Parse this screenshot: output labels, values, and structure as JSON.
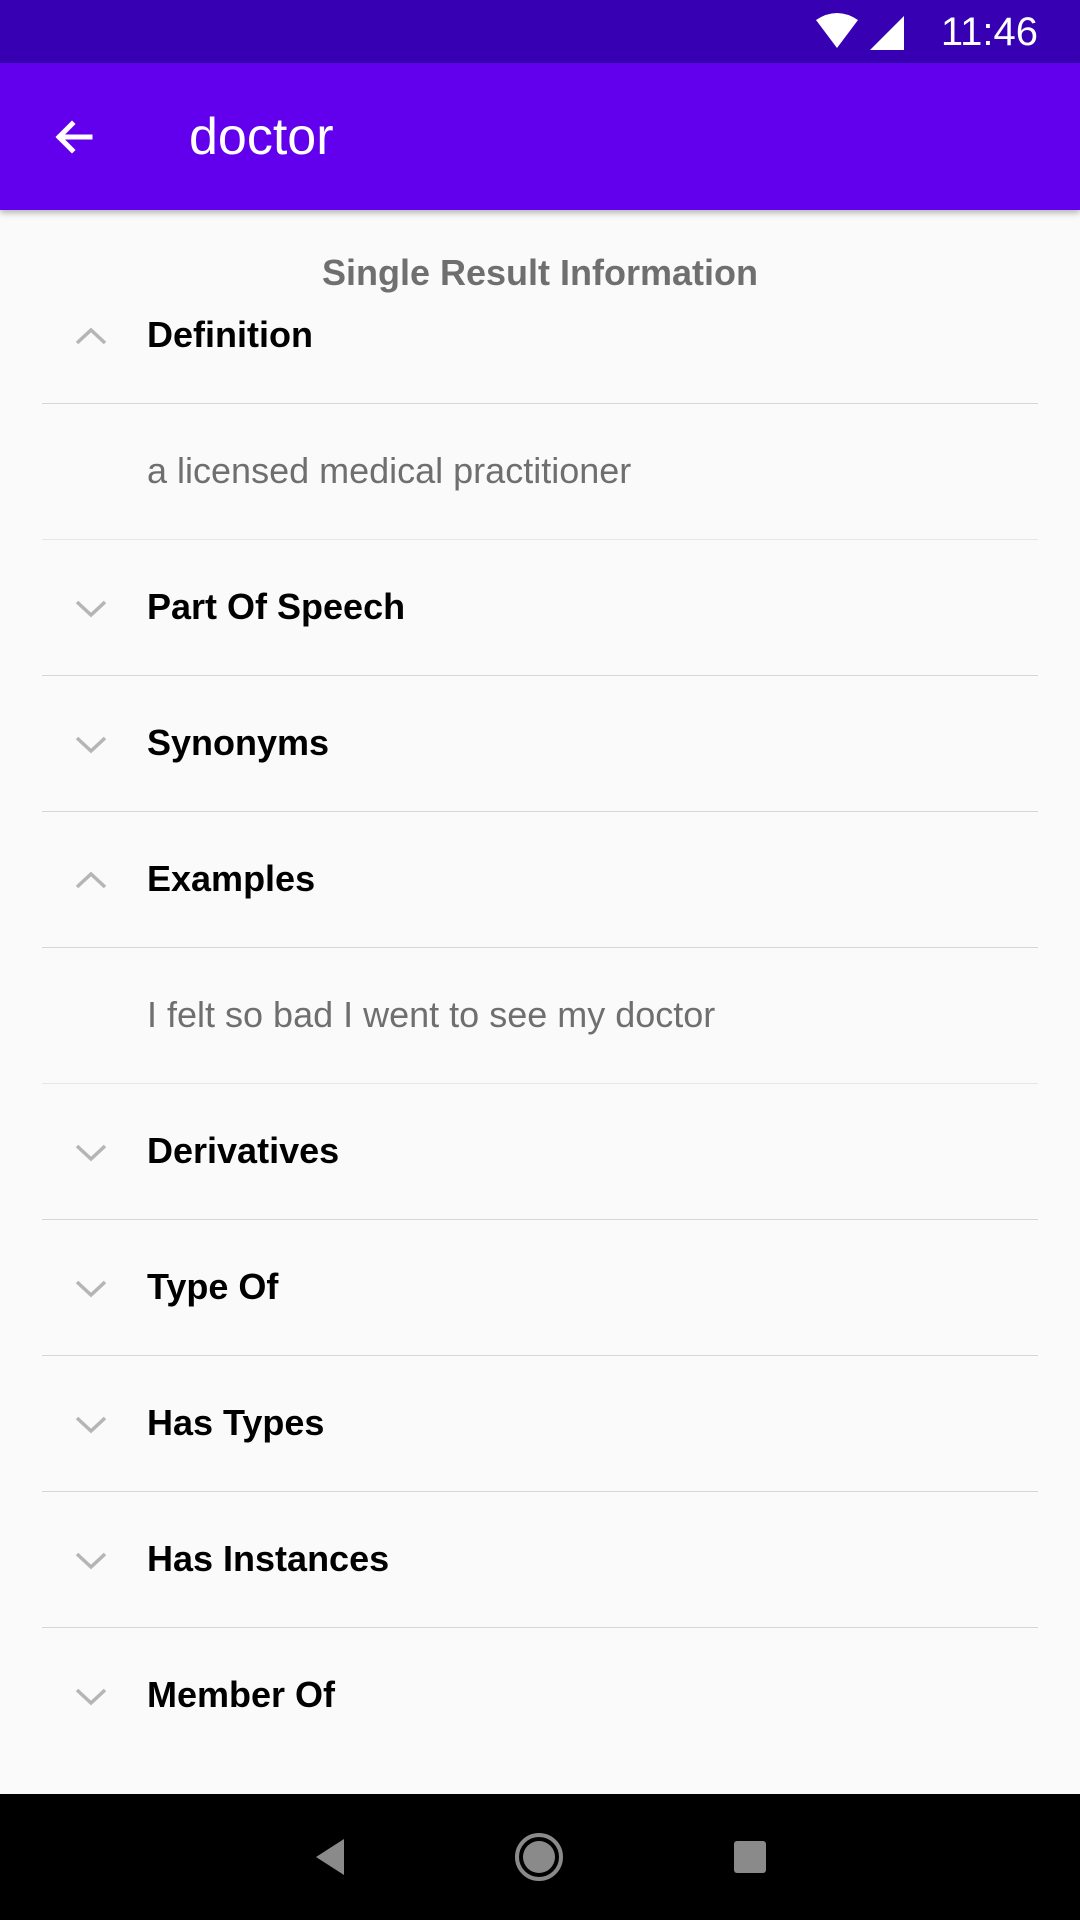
{
  "status_bar": {
    "time": "11:46",
    "icons": [
      "wifi-icon",
      "cell-signal-icon"
    ]
  },
  "app_bar": {
    "title": "doctor",
    "back_icon": "arrow-back-icon",
    "color": "#6200ee"
  },
  "content": {
    "header": "Single Result Information",
    "sections": [
      {
        "label": "Definition",
        "expanded": true,
        "value": "a licensed medical practitioner"
      },
      {
        "label": "Part Of Speech",
        "expanded": false
      },
      {
        "label": "Synonyms",
        "expanded": false
      },
      {
        "label": "Examples",
        "expanded": true,
        "value": "I felt so bad I went to see my doctor"
      },
      {
        "label": "Derivatives",
        "expanded": false
      },
      {
        "label": "Type Of",
        "expanded": false
      },
      {
        "label": "Has Types",
        "expanded": false
      },
      {
        "label": "Has Instances",
        "expanded": false
      },
      {
        "label": "Member Of",
        "expanded": false
      }
    ]
  },
  "nav_bar": {
    "buttons": [
      "back-triangle-icon",
      "home-circle-icon",
      "recents-square-icon"
    ]
  },
  "colors": {
    "status_bar": "#3700b3",
    "app_bar": "#6200ee",
    "background": "#fafafa",
    "secondary_text": "#6f6f6f"
  }
}
